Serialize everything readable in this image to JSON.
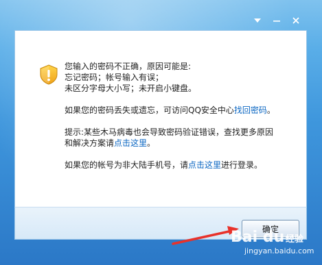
{
  "window": {
    "dropdown_icon": "chevron-down-icon",
    "minimize_icon": "minimize-icon",
    "close_icon": "close-icon"
  },
  "message": {
    "icon": "warning-shield-icon",
    "line1": "您输入的密码不正确，原因可能是:",
    "line2": "忘记密码；帐号输入有误；",
    "line3": "未区分字母大小写；未开启小键盘。",
    "lost_prefix": "如果您的密码丢失或遗忘，可访问QQ安全中心",
    "lost_link": "找回密码",
    "lost_suffix": "。",
    "hint_line1": "提示:某些木马病毒也会导致密码验证错误，查找更多原因",
    "hint_prefix": "和解决方案请",
    "hint_link": "点击这里",
    "hint_suffix": "。",
    "mobile_prefix": "如果您的帐号为非大陆手机号，请",
    "mobile_link": "点击这里",
    "mobile_suffix": "进行登录。"
  },
  "footer": {
    "ok_label": "确定"
  },
  "watermark": {
    "logo": "Bai du",
    "brand": "经验",
    "url": "jingyan.baidu.com"
  },
  "colors": {
    "link": "#0a66c2",
    "annotation_arrow": "#e8322a"
  }
}
